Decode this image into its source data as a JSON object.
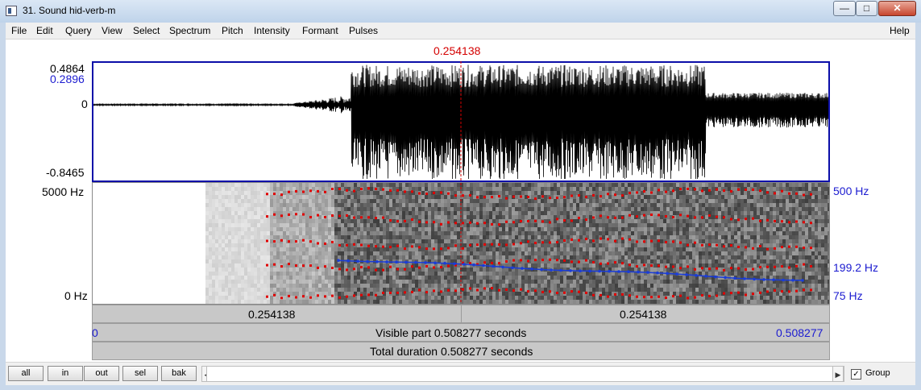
{
  "window": {
    "title": "31. Sound hid-verb-m",
    "minimize_icon": "minimize-icon",
    "maximize_icon": "maximize-icon",
    "close_icon": "close-icon"
  },
  "menu": {
    "items": [
      "File",
      "Edit",
      "Query",
      "View",
      "Select",
      "Spectrum",
      "Pitch",
      "Intensity",
      "Formant",
      "Pulses"
    ],
    "help": "Help"
  },
  "cursor_time": "0.254138",
  "waveform": {
    "y_max": "0.4864",
    "y_marker": "0.2896",
    "y_zero": "0",
    "y_min": "-0.8465"
  },
  "spectrogram": {
    "freq_top": "5000 Hz",
    "freq_bottom": "0 Hz",
    "pitch_top": "500 Hz",
    "pitch_value": "199.2 Hz",
    "pitch_bottom": "75 Hz"
  },
  "time_bars": {
    "left_segment": "0.254138",
    "right_segment": "0.254138",
    "visible_start": "0",
    "visible_label": "Visible part 0.508277 seconds",
    "visible_end": "0.508277",
    "total_label": "Total duration 0.508277 seconds"
  },
  "bottom": {
    "buttons": [
      "all",
      "in",
      "out",
      "sel",
      "bak"
    ],
    "group_label": "Group",
    "group_checked": true
  },
  "colors": {
    "cursor": "#d40000",
    "axis_blue": "#1b1bd0",
    "pitch_line": "#1a3cd8",
    "formant_dot": "#e00000",
    "window_bg": "#c9d8ea"
  }
}
